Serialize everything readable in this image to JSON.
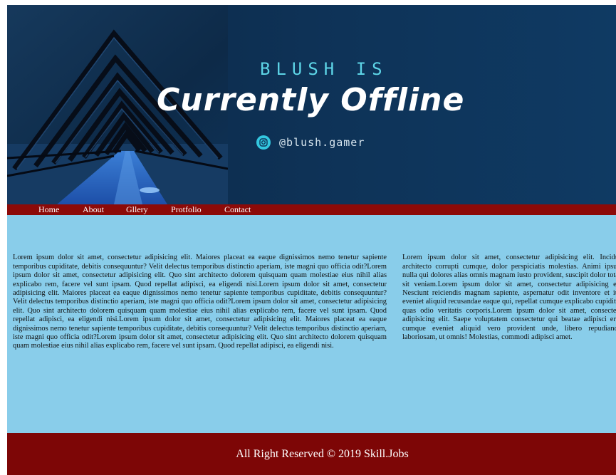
{
  "banner": {
    "heading_small": "BLUSH IS",
    "heading_big": "Currently Offline",
    "social_icon": "instagram-icon",
    "social_handle": "@blush.gamer"
  },
  "nav": {
    "items": [
      "Home",
      "About",
      "Gllery",
      "Protfolio",
      "Contact"
    ]
  },
  "content": {
    "main_text": "Lorem ipsum dolor sit amet, consectetur adipisicing elit. Maiores placeat ea eaque dignissimos nemo tenetur sapiente temporibus cupiditate, debitis consequuntur? Velit delectus temporibus distinctio aperiam, iste magni quo officia odit?Lorem ipsum dolor sit amet, consectetur adipisicing elit. Quo sint architecto dolorem quisquam quam molestiae eius nihil alias explicabo rem, facere vel sunt ipsam. Quod repellat adipisci, ea eligendi nisi.Lorem ipsum dolor sit amet, consectetur adipisicing elit. Maiores placeat ea eaque dignissimos nemo tenetur sapiente temporibus cupiditate, debitis consequuntur? Velit delectus temporibus distinctio aperiam, iste magni quo officia odit?Lorem ipsum dolor sit amet, consectetur adipisicing elit. Quo sint architecto dolorem quisquam quam molestiae eius nihil alias explicabo rem, facere vel sunt ipsam. Quod repellat adipisci, ea eligendi nisi.Lorem ipsum dolor sit amet, consectetur adipisicing elit. Maiores placeat ea eaque dignissimos nemo tenetur sapiente temporibus cupiditate, debitis consequuntur? Velit delectus temporibus distinctio aperiam, iste magni quo officia odit?Lorem ipsum dolor sit amet, consectetur adipisicing elit. Quo sint architecto dolorem quisquam quam molestiae eius nihil alias explicabo rem, facere vel sunt ipsam. Quod repellat adipisci, ea eligendi nisi.",
    "side_text": "Lorem ipsum dolor sit amet, consectetur adipisicing elit. Incidunt architecto corrupti cumque, dolor perspiciatis molestias. Animi ipsum, nulla qui dolores alias omnis magnam iusto provident, suscipit dolor totam sit veniam.Lorem ipsum dolor sit amet, consectetur adipisicing elit. Nesciunt reiciendis magnam sapiente, aspernatur odit inventore et iure eveniet aliquid recusandae eaque qui, repellat cumque explicabo cupiditate quas odio veritatis corporis.Lorem ipsum dolor sit amet, consectetur adipisicing elit. Saepe voluptatem consectetur qui beatae adipisci error cumque eveniet aliquid vero provident unde, libero repudiandae laboriosam, ut omnis! Molestias, commodi adipisci amet."
  },
  "footer": {
    "text": "All Right Reserved © 2019 Skill.Jobs"
  },
  "colors": {
    "banner_bg": "#0e3358",
    "accent_cyan": "#5dd4e6",
    "nav_bg": "#8c0a08",
    "content_bg": "#89cdea",
    "footer_bg": "#7d0606"
  }
}
